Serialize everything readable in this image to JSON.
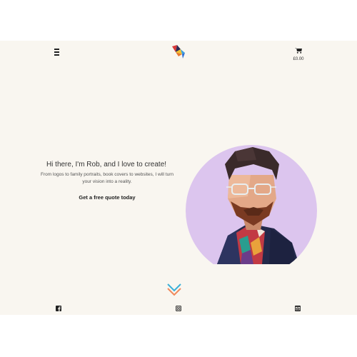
{
  "header": {
    "menu_icon": "hamburger-menu-icon",
    "logo_icon": "colorful-bird-logo",
    "cart_icon": "shopping-cart-icon",
    "cart_total": "£0.00"
  },
  "hero": {
    "title": "Hi there, I'm Rob, and I love to create!",
    "subtitle": "From logos to family portraits, book covers to websites, I will turn your vision into a reality.",
    "cta_label": "Get a free quote today"
  },
  "scroll_icon": "chevron-down-icon",
  "footer": {
    "social_icons": [
      "facebook-icon",
      "instagram-icon",
      "email-icon"
    ]
  },
  "colors": {
    "page_background": "#f9f6f0",
    "portrait_circle": "#dcc5ee",
    "chevron_blue": "#3ab0d8",
    "chevron_orange": "#f08a5d"
  }
}
